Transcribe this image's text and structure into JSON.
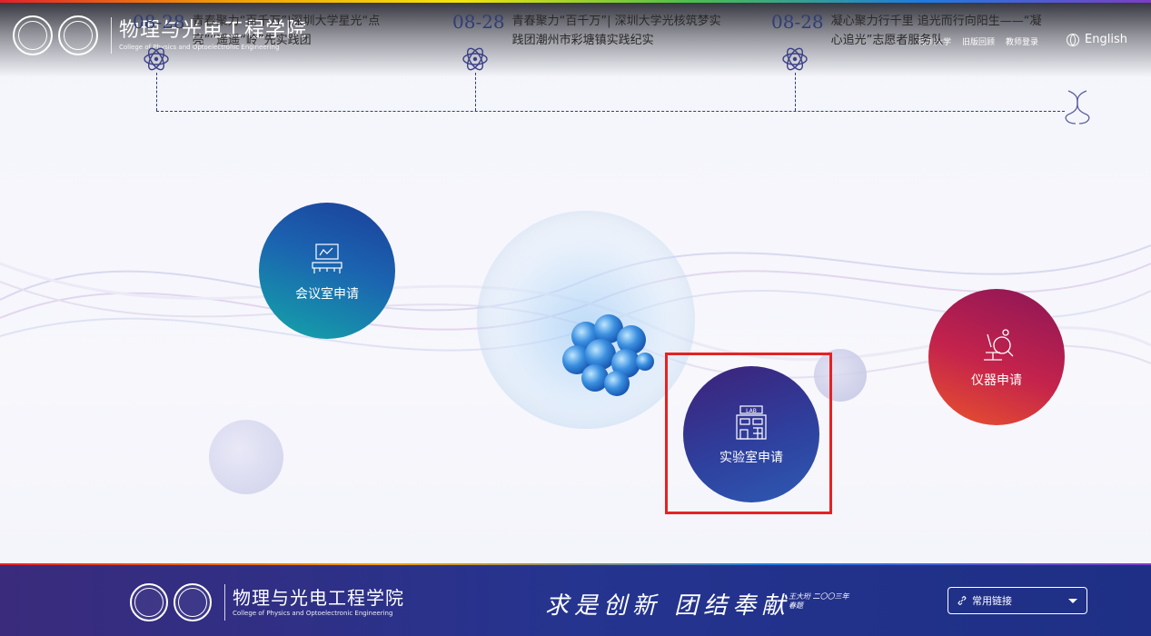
{
  "header": {
    "college_name": "物理与光电工程学院",
    "college_name_en": "College of Physics and Optoelectronic Engineering",
    "top_links": [
      "深圳大学",
      "旧版回顾",
      "教师登录"
    ],
    "language": "English"
  },
  "news": [
    {
      "date": "08-28",
      "title": "青春聚力“百千万”|深圳大学星光“点亮”“遥遥“岭”先实践团"
    },
    {
      "date": "08-28",
      "title": "青春聚力“百千万”| 深圳大学光核筑梦实践团潮州市彩塘镇实践纪实"
    },
    {
      "date": "08-28",
      "title": "凝心聚力行千里 追光而行向阳生——“凝心追光”志愿者服务队"
    }
  ],
  "services": {
    "meeting": "会议室申请",
    "lab": "实验室申请",
    "instrument": "仪器申请"
  },
  "footer": {
    "college_name": "物理与光电工程学院",
    "college_name_en": "College of Physics and Optoelectronic Engineering",
    "motto": "求是创新 团结奉献",
    "motto_sign": "王大珩 二〇〇三年春题",
    "links_label": "常用链接"
  },
  "colors": {
    "accent": "#2f3d7a",
    "highlight": "#e52224"
  }
}
